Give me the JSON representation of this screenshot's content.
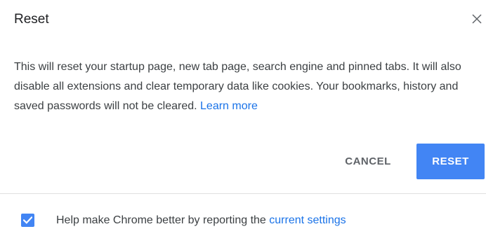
{
  "dialog": {
    "title": "Reset",
    "close_icon": "close-icon",
    "body_text": "This will reset your startup page, new tab page, search engine and pinned tabs. It will also disable all extensions and clear temporary data like cookies. Your bookmarks, history and saved passwords will not be cleared. ",
    "learn_more": "Learn more",
    "cancel_label": "CANCEL",
    "reset_label": "RESET"
  },
  "footer": {
    "checkbox_checked": true,
    "checkbox_icon": "checkmark-icon",
    "text": "Help make Chrome better by reporting the ",
    "link": "current settings"
  },
  "colors": {
    "accent": "#4285f4",
    "link": "#1a73e8",
    "text": "#3c4043",
    "muted": "#5f6368"
  }
}
